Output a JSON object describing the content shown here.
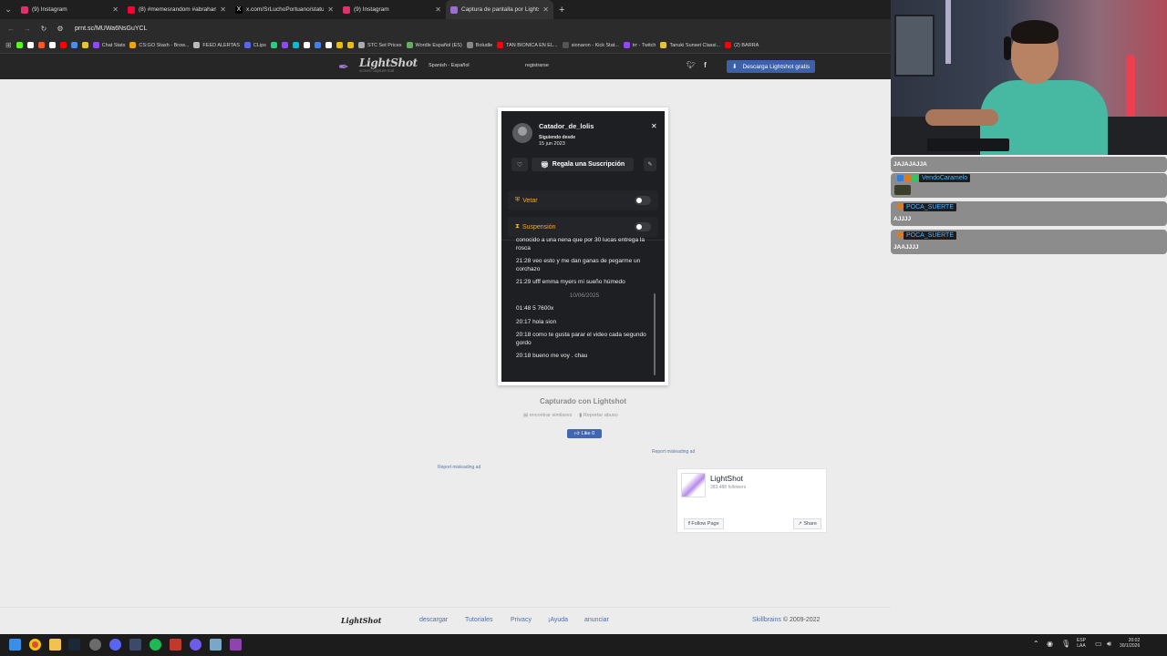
{
  "browser": {
    "tabs": [
      {
        "title": "(9) Instagram",
        "color": "#e1306c"
      },
      {
        "title": "(8) #memesrandom #abraham",
        "color": "#ff0033"
      },
      {
        "title": "x.com/SrLuchoPortuano/status",
        "color": "#000000"
      },
      {
        "title": "(9) Instagram",
        "color": "#e1306c"
      },
      {
        "title": "Captura de pantalla por Lightsh",
        "color": "#9b6fd1"
      }
    ],
    "new_tab": "+",
    "url": "prnt.sc/MUWa6NsGuYCL",
    "bookmarks": [
      {
        "label": "",
        "color": "#53fc18"
      },
      {
        "label": "",
        "color": "#ffffff"
      },
      {
        "label": "",
        "color": "#ff5722"
      },
      {
        "label": "",
        "color": "#ffffff"
      },
      {
        "label": "",
        "color": "#ff0000"
      },
      {
        "label": "",
        "color": "#4a90e2"
      },
      {
        "label": "",
        "color": "#e8c33a"
      },
      {
        "label": "Chat Stats",
        "color": "#9146ff"
      },
      {
        "label": "CS:GO Stash - Brow...",
        "color": "#f0a500"
      },
      {
        "label": "FEED ALERTAS",
        "color": "#bbbbbb"
      },
      {
        "label": "CLips",
        "color": "#5865f2"
      },
      {
        "label": "",
        "color": "#26d07c"
      },
      {
        "label": "",
        "color": "#9146ff"
      },
      {
        "label": "",
        "color": "#00bcd4"
      },
      {
        "label": "",
        "color": "#ffffff"
      },
      {
        "label": "",
        "color": "#3b82f6"
      },
      {
        "label": "",
        "color": "#ffffff"
      },
      {
        "label": "",
        "color": "#f0b90b"
      },
      {
        "label": "",
        "color": "#f0b90b"
      },
      {
        "label": "STC Set Prices",
        "color": "#aaaaaa"
      },
      {
        "label": "Wordle Español (ES)",
        "color": "#6aaa64"
      },
      {
        "label": "Boludle",
        "color": "#888888"
      },
      {
        "label": "TAN BIONICA EN EL...",
        "color": "#ff0000"
      },
      {
        "label": "sionaron - Kick Stat...",
        "color": "#555555"
      },
      {
        "label": "trr - Twitch",
        "color": "#9146ff"
      },
      {
        "label": "Tanuki Sunset Classi...",
        "color": "#e8c33a"
      },
      {
        "label": "(2) BARRA",
        "color": "#ff0000"
      }
    ]
  },
  "lightshot": {
    "logo": "LightShot",
    "logo_sub": "screen capture tool",
    "language": "Spanish - Español",
    "register": "registrarse",
    "download_button": "Descarga Lightshot gratis",
    "captured_text": "Capturado con Lightshot",
    "find_similar": "encontrar similares",
    "report_abuse": "Reportar abuso",
    "like_button": "Like 0",
    "report_ad_1": "Report misleading ad",
    "report_ad_2": "Report misleading ad",
    "fb": {
      "name": "LightShot",
      "followers": "383,488 followers",
      "follow": "Follow Page",
      "share": "Share"
    },
    "footer": {
      "logo": "LightShot",
      "links": [
        "descargar",
        "Tutoriales",
        "Privacy",
        "¡Ayuda",
        "anunciar"
      ],
      "copyright_brand": "Skillbrains",
      "copyright_years": "© 2009-2022"
    }
  },
  "screenshot": {
    "username": "Catador_de_lolis",
    "following_label": "Siguiendo desde",
    "following_date": "15 jun 2023",
    "gift_button": "Regala una Suscripción",
    "veto_label": "Vetar",
    "suspension_label": "Suspensión",
    "chat": [
      {
        "text": "conocido a una nena que por 30 lucas entrega la rosca",
        "cut": true
      },
      {
        "text": "21:28 veo esto y me dan ganas de pegarme un corchazo"
      },
      {
        "text": "21:29 ufff emma myers mi sueño húmedo"
      }
    ],
    "date_separator": "10/06/2025",
    "chat2": [
      {
        "text": "01:48 5 7600x"
      },
      {
        "text": "20:17 hola sion"
      },
      {
        "text": "20:18 como te gusta parar el video cada segundo gordo"
      },
      {
        "text": "20:18 bueno me voy . chau"
      }
    ]
  },
  "stream_chat": [
    {
      "user": "",
      "text": "JAJAJAJJA"
    },
    {
      "user": "VendoCaramelo",
      "text": ""
    },
    {
      "user": "POCA_SUERTE",
      "text": "AJJJJ"
    },
    {
      "user": "POCA_SUERTE",
      "text": "JAAJJJJ"
    }
  ],
  "taskbar": {
    "lang_line1": "ESP",
    "lang_line2": "LAA",
    "time": "20:02",
    "date": "30/1/2026"
  }
}
